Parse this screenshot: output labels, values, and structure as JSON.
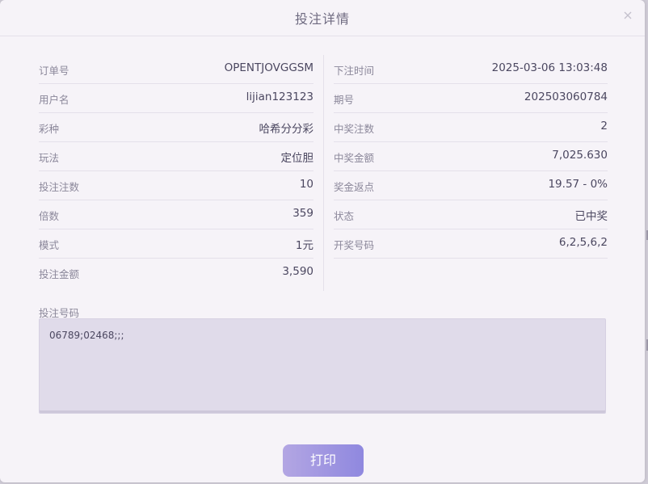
{
  "dialog": {
    "title": "投注详情",
    "close_icon": "close-icon"
  },
  "left_fields": [
    {
      "label": "订单号",
      "value": "OPENTJOVGGSM"
    },
    {
      "label": "用户名",
      "value": "lijian123123"
    },
    {
      "label": "彩种",
      "value": "哈希分分彩"
    },
    {
      "label": "玩法",
      "value": "定位胆"
    },
    {
      "label": "投注注数",
      "value": "10"
    },
    {
      "label": "倍数",
      "value": "359"
    },
    {
      "label": "模式",
      "value": "1元"
    },
    {
      "label": "投注金额",
      "value": "3,590"
    }
  ],
  "right_fields": [
    {
      "label": "下注时间",
      "value": "2025-03-06 13:03:48"
    },
    {
      "label": "期号",
      "value": "202503060784"
    },
    {
      "label": "中奖注数",
      "value": "2"
    },
    {
      "label": "中奖金额",
      "value": "7,025.630"
    },
    {
      "label": "奖金返点",
      "value": "19.57 - 0%"
    },
    {
      "label": "状态",
      "value": "已中奖"
    },
    {
      "label": "开奖号码",
      "value": "6,2,5,6,2"
    }
  ],
  "bet_numbers": {
    "label": "投注号码",
    "value": "06789;02468;;;"
  },
  "actions": {
    "print_label": "打印"
  },
  "colors": {
    "accent_start": "#b3a6e3",
    "accent_end": "#8f88df",
    "background": "#f6f3f8"
  }
}
